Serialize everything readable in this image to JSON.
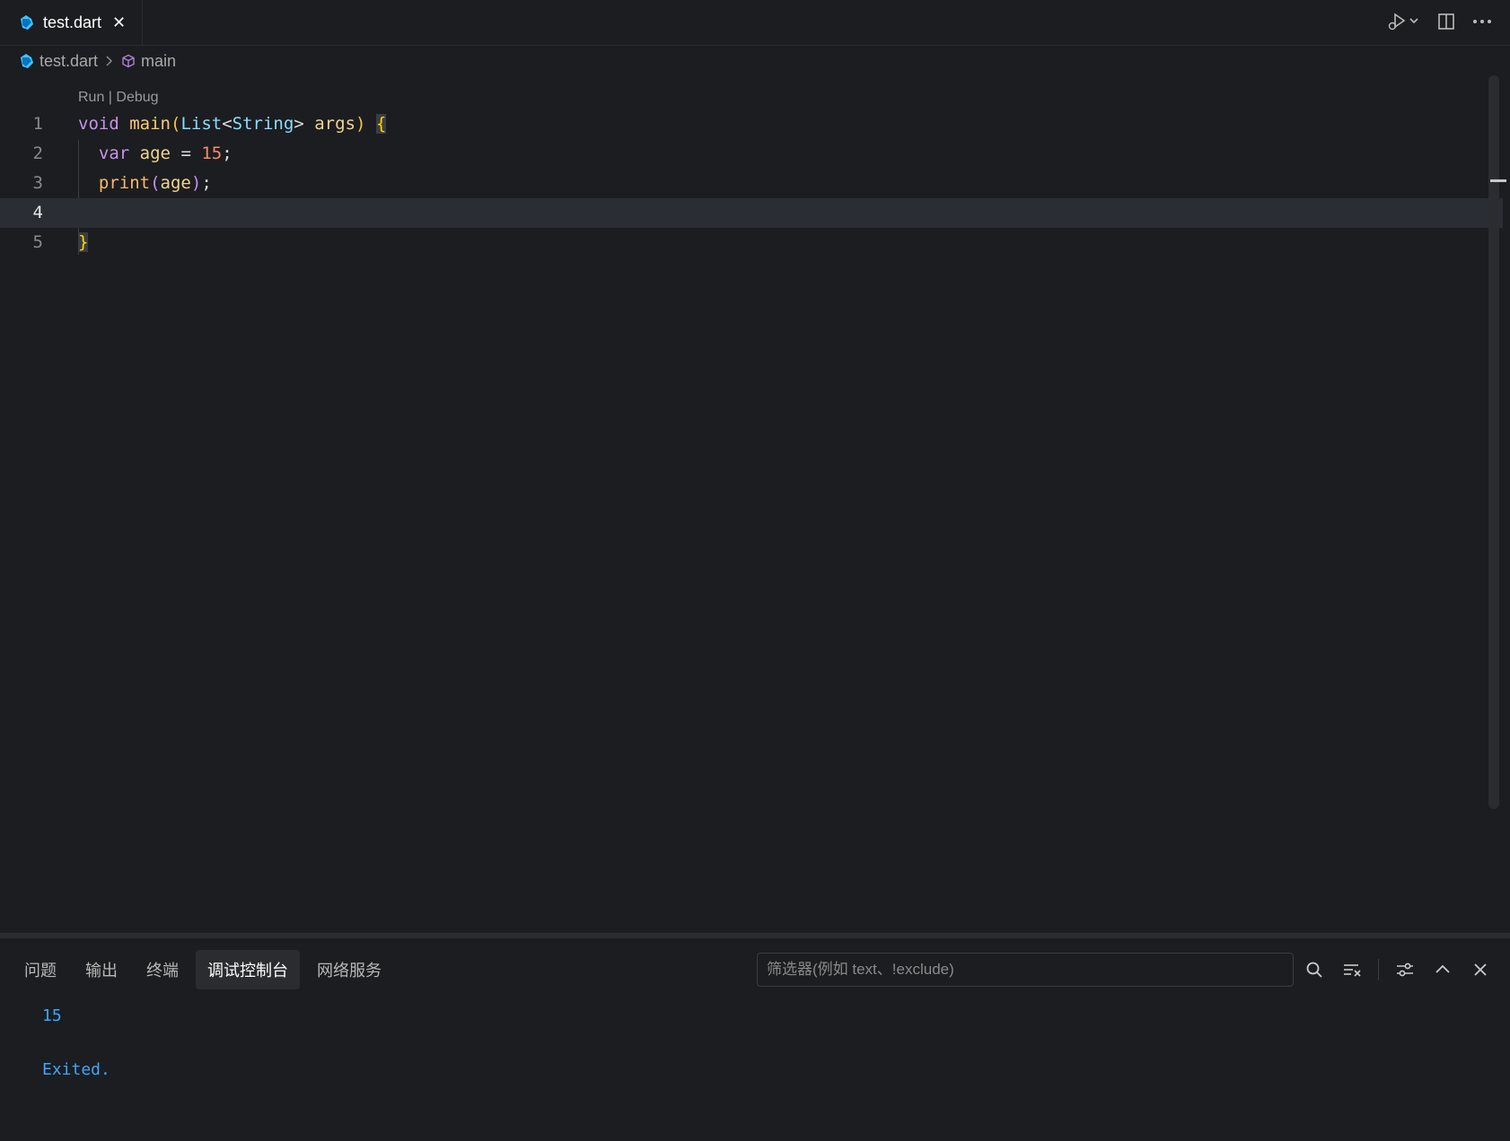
{
  "tab": {
    "label": "test.dart",
    "close": "✕"
  },
  "breadcrumb": {
    "file": "test.dart",
    "symbol": "main"
  },
  "codelens": {
    "run": "Run",
    "sep": " | ",
    "debug": "Debug"
  },
  "lines": [
    {
      "number": "1"
    },
    {
      "number": "2"
    },
    {
      "number": "3"
    },
    {
      "number": "4"
    },
    {
      "number": "5"
    }
  ],
  "code": {
    "l1": {
      "kw": "void",
      "fn": "main",
      "p1": "(",
      "type1": "List",
      "lt": "<",
      "type2": "String",
      "gt": ">",
      "arg": "args",
      "p2": ")",
      "brace": "{"
    },
    "l2": {
      "kw": "var",
      "name": "age",
      "eq": " = ",
      "num": "15",
      "semi": ";"
    },
    "l3": {
      "fn": "print",
      "p1": "(",
      "arg": "age",
      "p2": ")",
      "semi": ";"
    },
    "l5": {
      "brace": "}"
    }
  },
  "panel": {
    "tabs": [
      "问题",
      "输出",
      "终端",
      "调试控制台",
      "网络服务"
    ],
    "active_tab": "调试控制台",
    "filter_placeholder": "筛选器(例如 text、!exclude)",
    "console_lines": [
      "15",
      "",
      "Exited."
    ]
  },
  "colors": {
    "accent": "#3ea6ff",
    "background": "#1b1d20"
  }
}
